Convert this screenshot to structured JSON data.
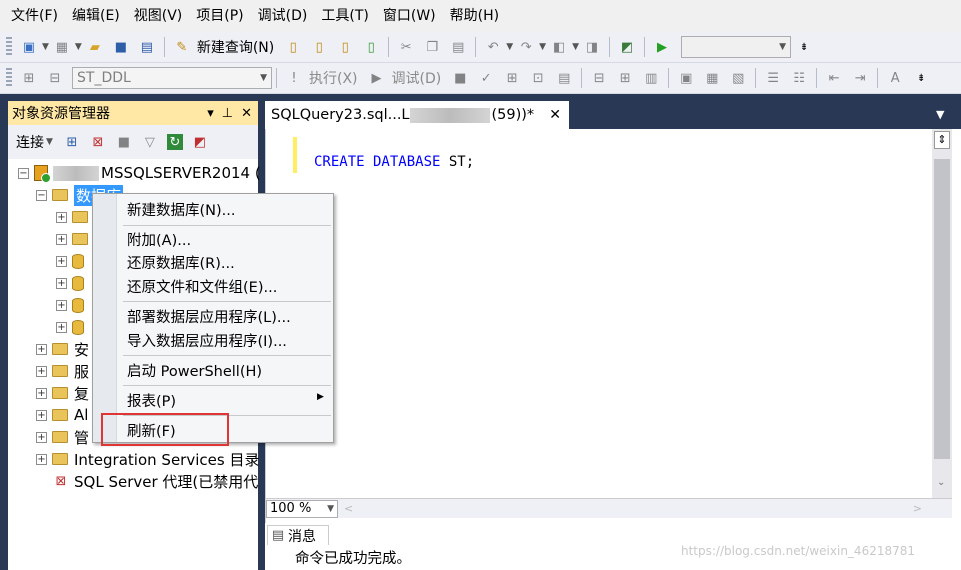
{
  "menubar": [
    "文件(F)",
    "编辑(E)",
    "视图(V)",
    "项目(P)",
    "调试(D)",
    "工具(T)",
    "窗口(W)",
    "帮助(H)"
  ],
  "toolbar1": {
    "new_query": "新建查询(N)"
  },
  "toolbar2": {
    "database_combo": "ST_DDL",
    "execute": "执行(X)",
    "debug": "调试(D)"
  },
  "object_explorer": {
    "title": "对象资源管理器",
    "pin": "▾ ⊥ ✕",
    "connect_label": "连接",
    "server_suffix": "MSSQLSERVER2014 (",
    "databases_label": "数据库",
    "tree": [
      {
        "label": "安"
      },
      {
        "label": "服"
      },
      {
        "label": "复"
      },
      {
        "label": "Al"
      },
      {
        "label": "管"
      },
      {
        "label": "Integration Services 目录"
      },
      {
        "label": "SQL Server 代理(已禁用代"
      }
    ]
  },
  "editor": {
    "tab_prefix": "SQLQuery23.sql...L",
    "tab_suffix": "(59))*",
    "code_keyword": "CREATE DATABASE",
    "code_rest": " ST;",
    "zoom": "100 %"
  },
  "messages": {
    "tab": "消息",
    "text": "命令已成功完成。",
    "watermark": "https://blog.csdn.net/weixin_46218781"
  },
  "context_menu": [
    "新建数据库(N)...",
    "附加(A)...",
    "还原数据库(R)...",
    "还原文件和文件组(E)...",
    "部署数据层应用程序(L)...",
    "导入数据层应用程序(I)...",
    "启动 PowerShell(H)",
    "报表(P)",
    "刷新(F)"
  ],
  "colors": {
    "chrome_dark": "#293955",
    "oe_title": "#ffe8a6",
    "selection": "#3399ff",
    "highlight_box": "#e03535"
  }
}
